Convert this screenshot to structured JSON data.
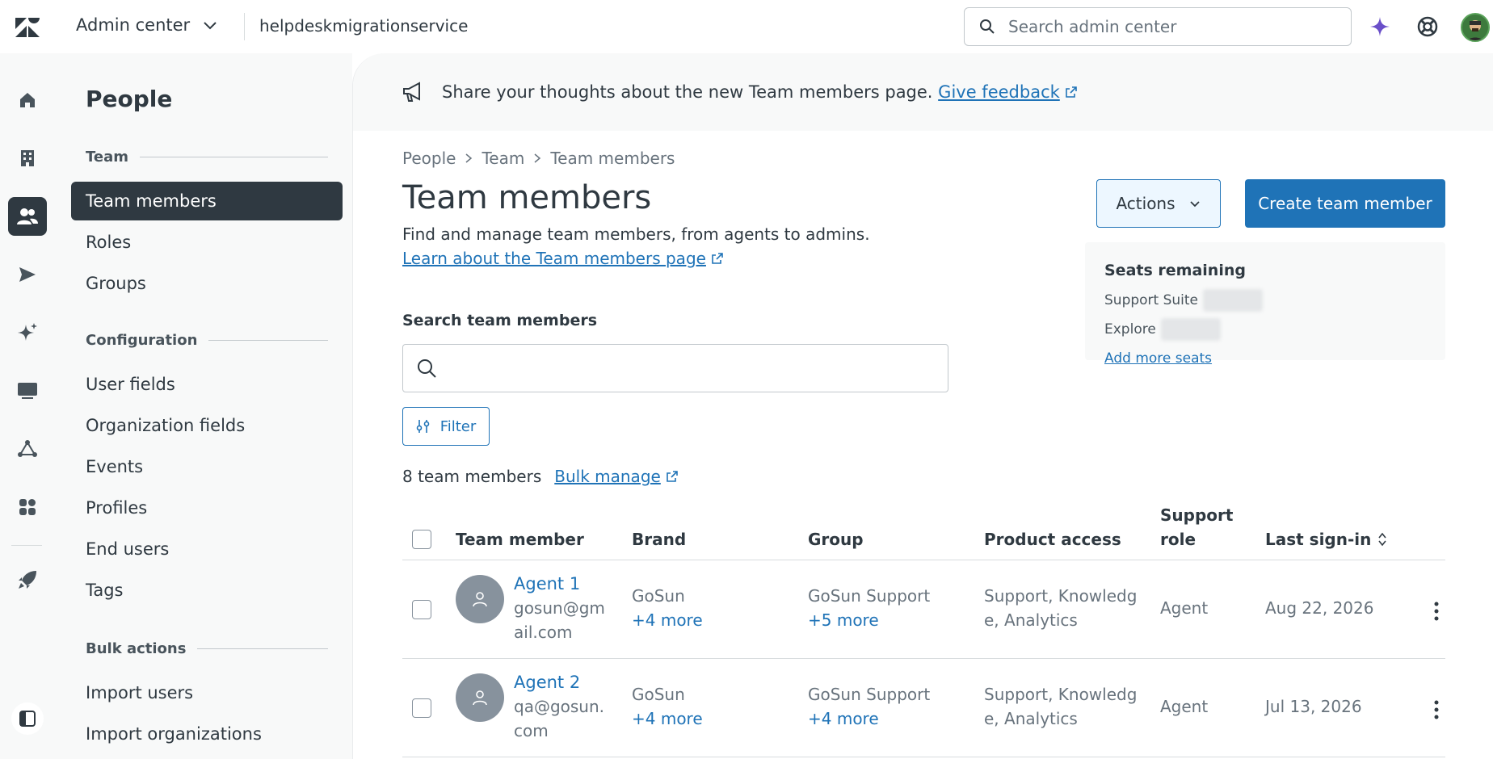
{
  "topbar": {
    "product": "Admin center",
    "account": "helpdeskmigrationservice",
    "search_placeholder": "Search admin center",
    "icons": [
      "zendesk-logo-icon",
      "sparkle-icon",
      "help-lifebuoy-icon",
      "user-avatar"
    ]
  },
  "rail": {
    "items": [
      "home-icon",
      "building-icon",
      "people-icon",
      "send-icon",
      "ai-sparkle-icon",
      "workspaces-icon",
      "objects-icon",
      "apps-icon",
      "rocket-icon",
      "sidebar-toggle-icon"
    ],
    "active": "people-icon"
  },
  "subnav": {
    "title": "People",
    "sections": [
      {
        "label": "Team",
        "items": [
          "Team members",
          "Roles",
          "Groups"
        ]
      },
      {
        "label": "Configuration",
        "items": [
          "User fields",
          "Organization fields",
          "Events",
          "Profiles",
          "End users",
          "Tags"
        ]
      },
      {
        "label": "Bulk actions",
        "items": [
          "Import users",
          "Import organizations"
        ]
      }
    ],
    "active_item": "Team members"
  },
  "banner": {
    "text": "Share your thoughts about the new Team members page.",
    "link": "Give feedback"
  },
  "breadcrumb": [
    "People",
    "Team",
    "Team members"
  ],
  "page": {
    "title": "Team members",
    "description": "Find and manage team members, from agents to admins.",
    "learn_link": "Learn about the Team members page",
    "actions_label": "Actions",
    "create_label": "Create team member"
  },
  "seats": {
    "title": "Seats remaining",
    "rows": [
      "Support Suite",
      "Explore"
    ],
    "add_link": "Add more seats"
  },
  "search": {
    "label": "Search team members",
    "placeholder": ""
  },
  "filter_label": "Filter",
  "count_text": "8 team members",
  "bulk_link": "Bulk manage",
  "table": {
    "headers": {
      "member": "Team member",
      "brand": "Brand",
      "group": "Group",
      "product": "Product access",
      "role_line1": "Support",
      "role_line2": "role",
      "last": "Last sign-in"
    },
    "rows": [
      {
        "name": "Agent 1",
        "email_line1": "gosun@gm",
        "email_line2": "ail.com",
        "brand": "GoSun",
        "brand_more": "+4 more",
        "group": "GoSun Support",
        "group_more": "+5 more",
        "product_line1": "Support, Knowledg",
        "product_line2": "e, Analytics",
        "role": "Agent",
        "last": "Aug 22, 2026"
      },
      {
        "name": "Agent 2",
        "email_line1": "qa@gosun.",
        "email_line2": "com",
        "brand": "GoSun",
        "brand_more": "+4 more",
        "group": "GoSun Support",
        "group_more": "+4 more",
        "product_line1": "Support, Knowledg",
        "product_line2": "e, Analytics",
        "role": "Agent",
        "last": "Jul 13, 2026"
      }
    ]
  },
  "colors": {
    "accent": "#1f73b7",
    "dark": "#2f3941",
    "muted": "#68737d",
    "sidebar_bg": "#f8f9f9"
  }
}
